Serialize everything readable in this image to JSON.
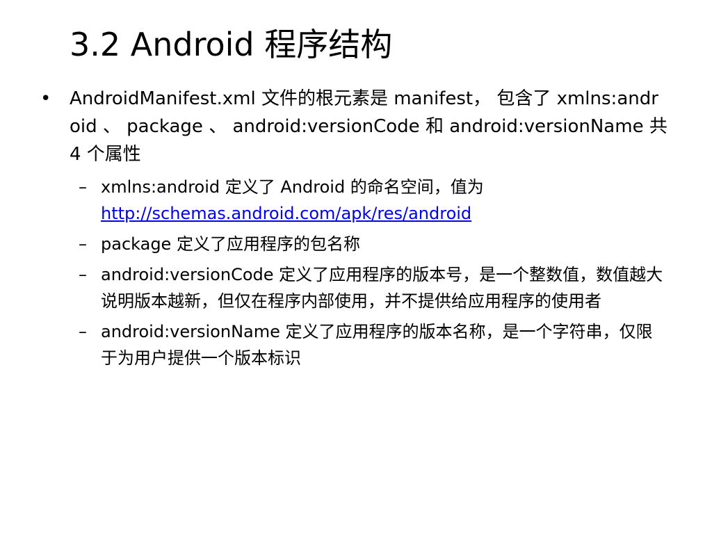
{
  "slide": {
    "title": "3.2 Android 程序结构",
    "main_bullet": {
      "marker": "•",
      "text": "AndroidManifest.xml 文件的根元素是 manifest， 包含了 xmlns:android 、 package 、 android:versionCode 和 android:versionName 共 4 个属性"
    },
    "sub_bullets": [
      {
        "marker": "–",
        "text": "xmlns:android 定义了 Android 的命名空间，值为",
        "link_text": "http://schemas.android.com/apk/res/android"
      },
      {
        "marker": "–",
        "text": "package 定义了应用程序的包名称"
      },
      {
        "marker": "–",
        "text": "android:versionCode 定义了应用程序的版本号，是一个整数值，数值越大说明版本越新，但仅在程序内部使用，并不提供给应用程序的使用者"
      },
      {
        "marker": "–",
        "text": "android:versionName 定义了应用程序的版本名称，是一个字符串，仅限于为用户提供一个版本标识"
      }
    ]
  }
}
